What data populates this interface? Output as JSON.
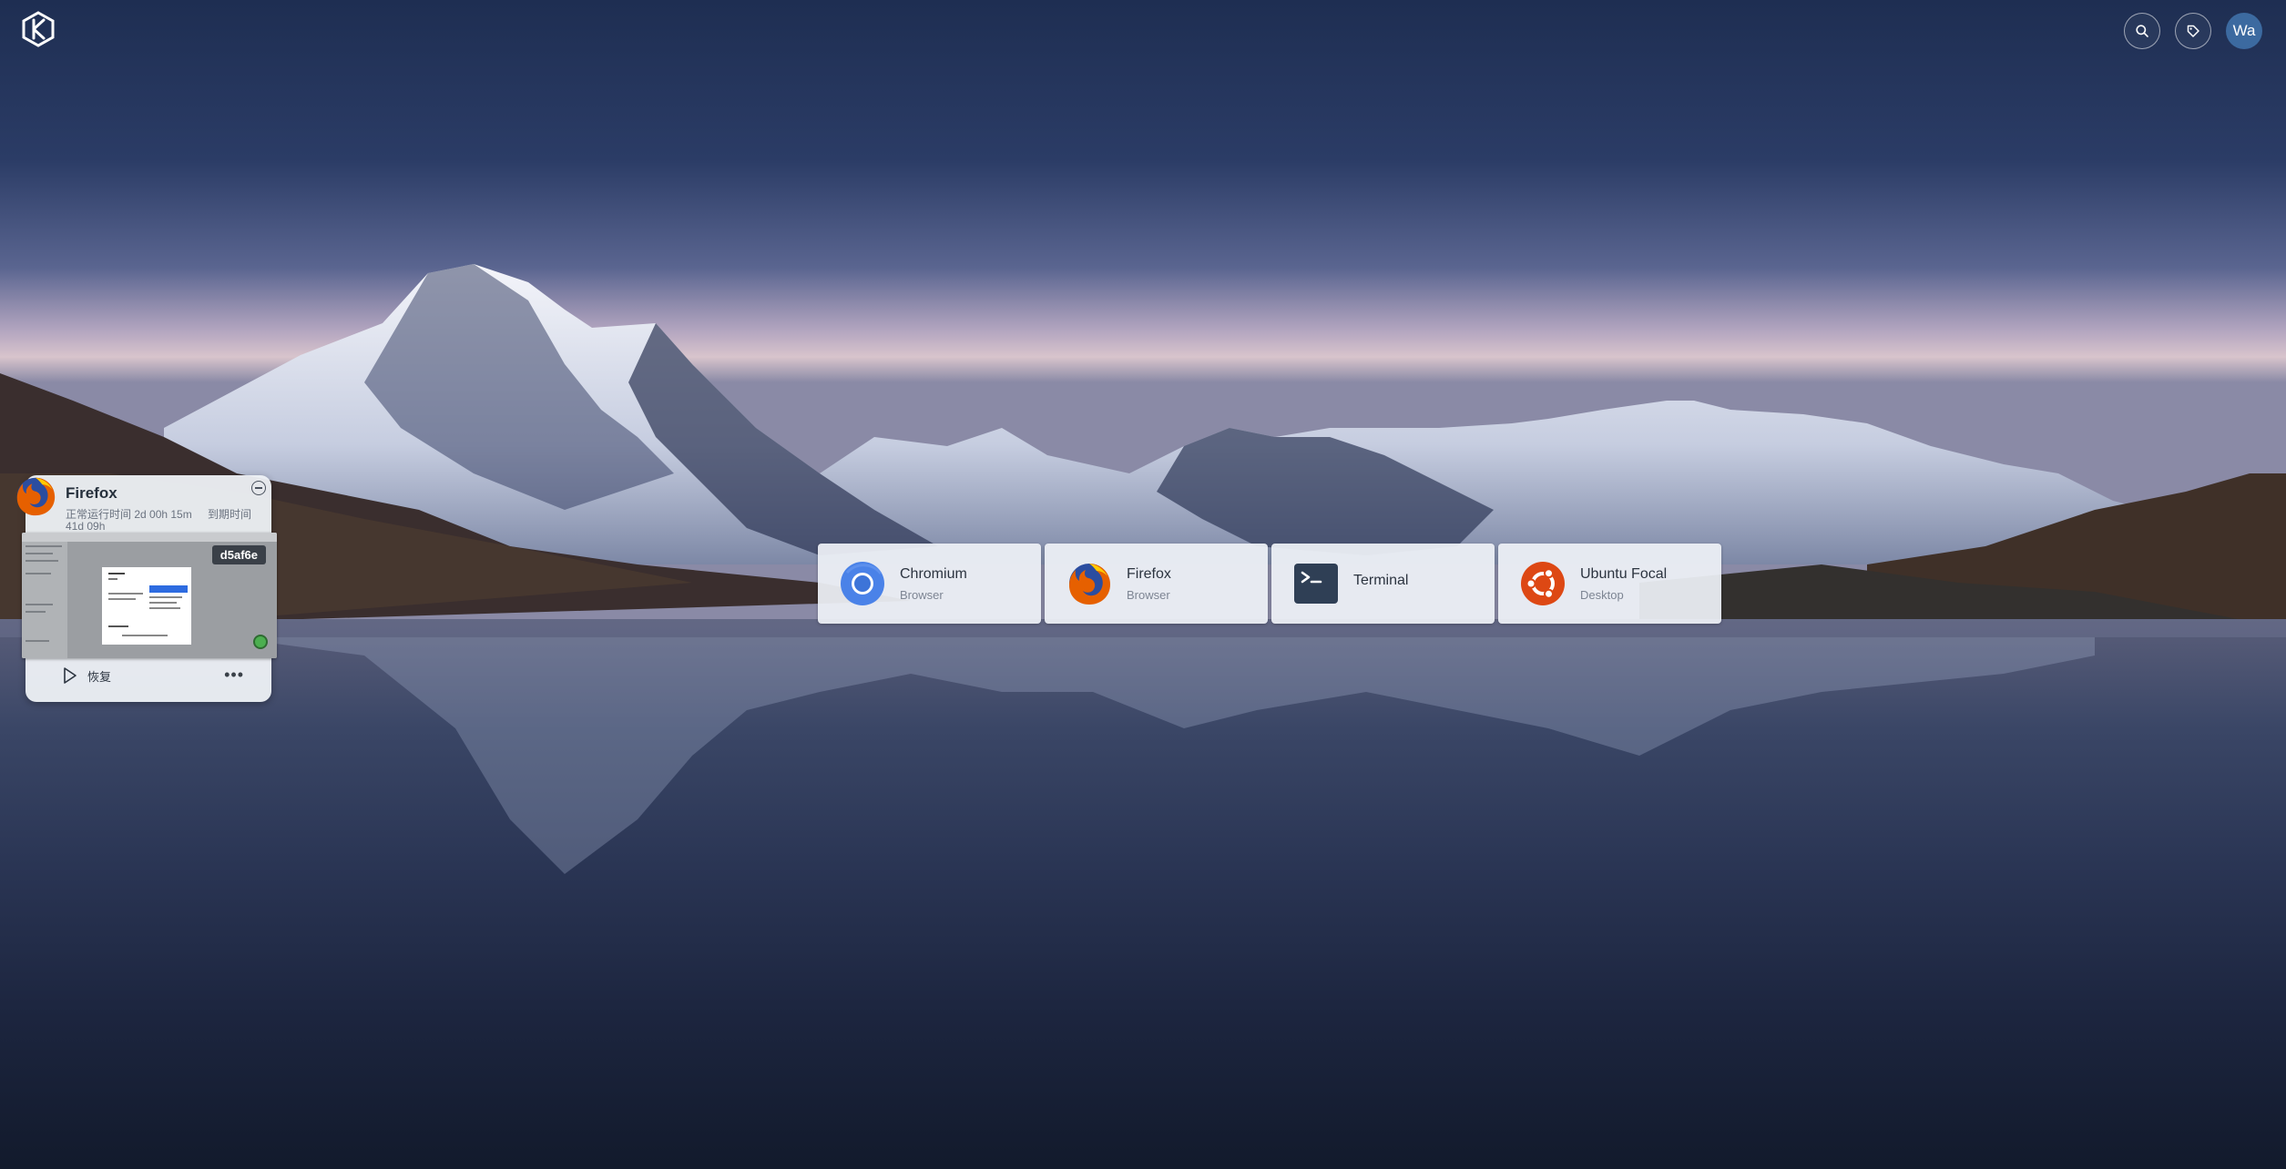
{
  "header": {
    "logo_icon": "kasm-logo-icon",
    "search_icon": "search-icon",
    "tag_icon": "tag-icon",
    "avatar_initials": "Wa",
    "avatar_color": "#3c6aa0"
  },
  "apps": [
    {
      "name": "Chromium",
      "category": "Browser",
      "icon": "chromium-icon"
    },
    {
      "name": "Firefox",
      "category": "Browser",
      "icon": "firefox-icon"
    },
    {
      "name": "Terminal",
      "category": "",
      "icon": "terminal-icon"
    },
    {
      "name": "Ubuntu Focal",
      "category": "Desktop",
      "icon": "ubuntu-icon"
    }
  ],
  "session": {
    "title": "Firefox",
    "uptime": "正常运行时间 2d 00h 15m",
    "expiry_label": "到期时间",
    "expiry_value": "41d 09h",
    "badge": "d5af6e",
    "status_color": "#4caf50",
    "resume_label": "恢复",
    "more_label": "•••"
  }
}
